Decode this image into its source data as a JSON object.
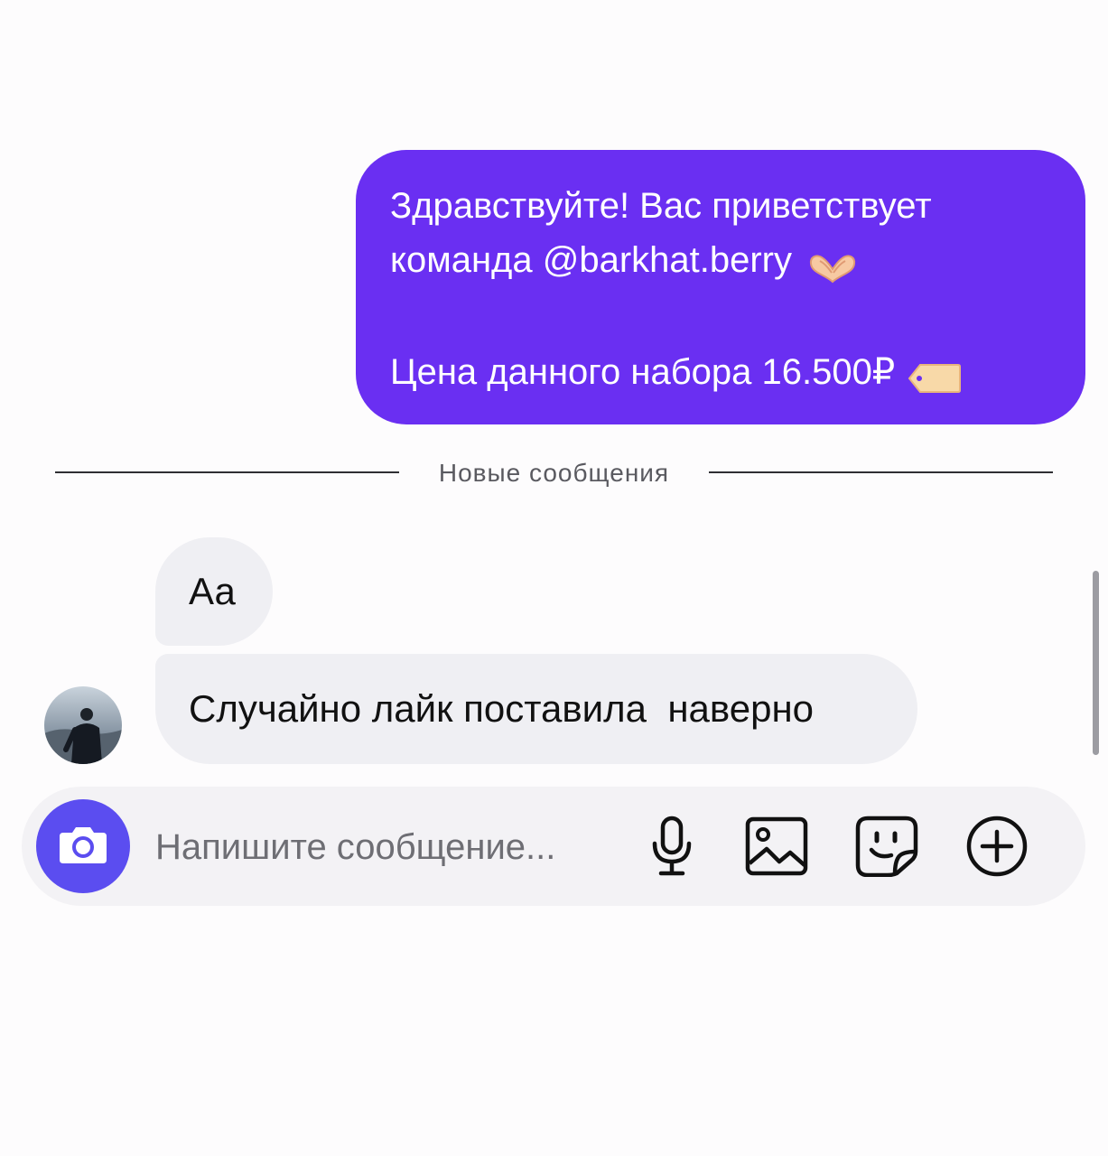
{
  "messages": {
    "outgoing": {
      "line1": "Здравствуйте! Вас приветствует",
      "line2": "команда @barkhat.berry",
      "line3": "Цена данного набора 16.500₽",
      "emoji1": "heart-hands-icon",
      "emoji2": "price-tag-icon"
    },
    "divider_label": "Новые сообщения",
    "incoming": [
      {
        "text": "Аа"
      },
      {
        "text": "Случайно лайк поставила  наверно"
      }
    ]
  },
  "composer": {
    "placeholder": "Напишите сообщение...",
    "icons": [
      "camera-icon",
      "microphone-icon",
      "gallery-icon",
      "sticker-icon",
      "plus-circle-icon"
    ]
  },
  "colors": {
    "outgoing_bubble": "#6a2ff2",
    "incoming_bubble": "#efeff3",
    "camera_button": "#5b4df0",
    "composer_bg": "#f3f2f5"
  }
}
